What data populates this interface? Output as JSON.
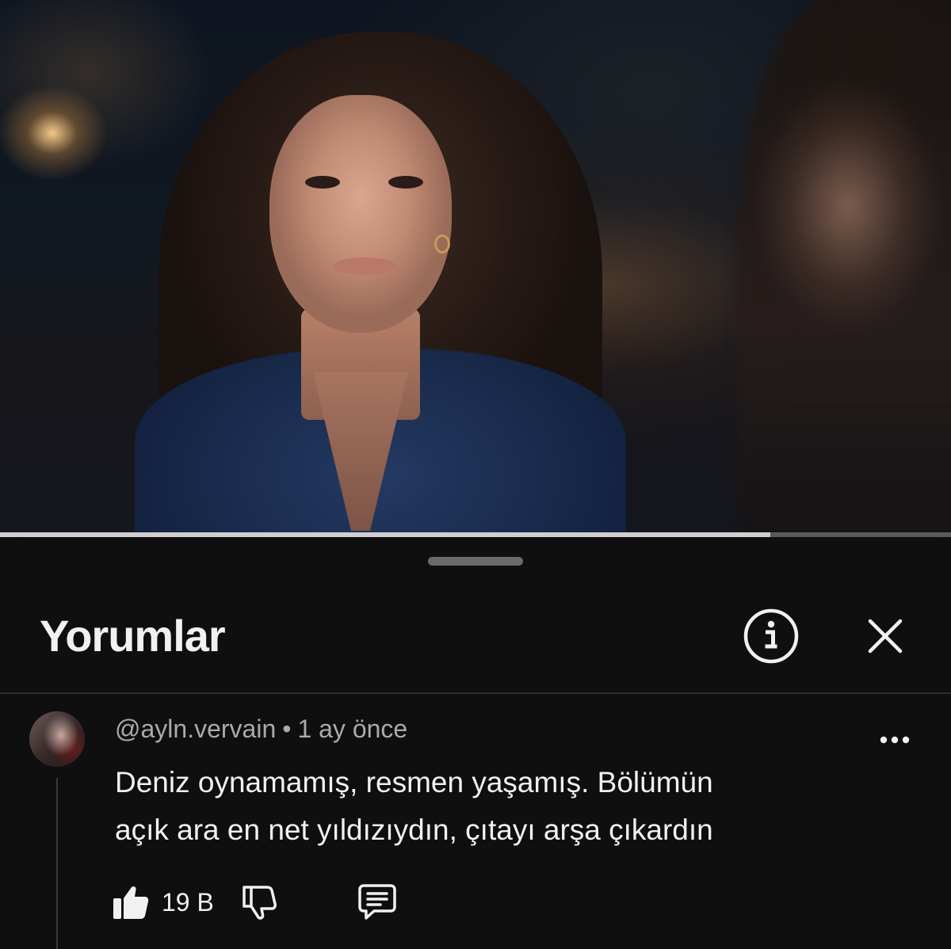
{
  "video": {
    "progress_fraction": 0.81
  },
  "comments_panel": {
    "title": "Yorumlar",
    "icons": {
      "info": "info-circle-icon",
      "close": "close-icon",
      "more": "more-horizontal-icon",
      "like": "thumbs-up-filled-icon",
      "dislike": "thumbs-down-outline-icon",
      "reply": "comment-reply-icon"
    }
  },
  "comments": [
    {
      "author": "@ayln.vervain",
      "separator": "•",
      "time": "1 ay önce",
      "text_line1": "Deniz oynamamış, resmen yaşamış. Bölümün",
      "text_line2": "açık ara en net yıldızıydın, çıtayı arşa çıkardın",
      "likes": "19 B"
    }
  ],
  "colors": {
    "sheet_background": "#0f0f0f",
    "primary_text": "#f1f1f1",
    "secondary_text": "#aaaaaa",
    "divider": "#2c2c2c",
    "progress_track": "#5a5a5a",
    "progress_fill": "#cfcfcf"
  }
}
